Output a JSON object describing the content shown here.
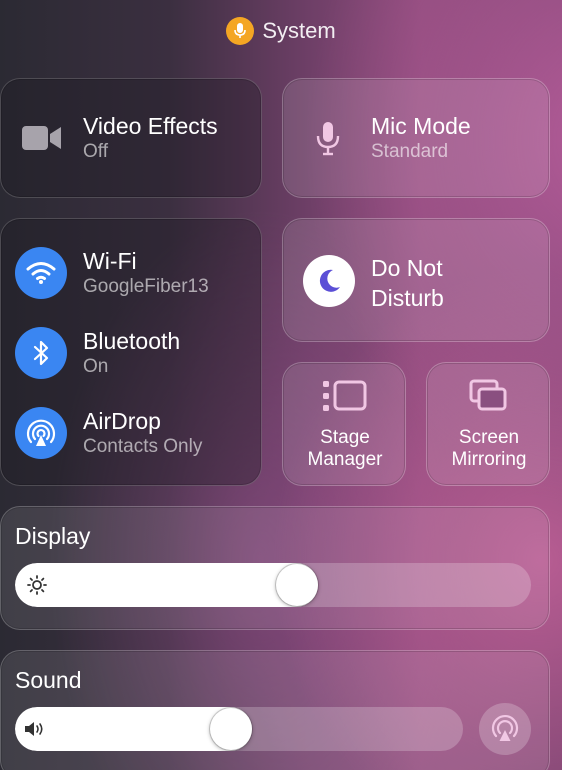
{
  "header": {
    "title": "System",
    "icon": "microphone-icon",
    "badge_color": "#f4a623"
  },
  "video_effects": {
    "title": "Video Effects",
    "status": "Off",
    "icon": "video-camera-icon"
  },
  "mic_mode": {
    "title": "Mic Mode",
    "status": "Standard",
    "icon": "microphone-icon"
  },
  "connectivity": {
    "wifi": {
      "title": "Wi-Fi",
      "status": "GoogleFiber13",
      "icon": "wifi-icon"
    },
    "bluetooth": {
      "title": "Bluetooth",
      "status": "On",
      "icon": "bluetooth-icon"
    },
    "airdrop": {
      "title": "AirDrop",
      "status": "Contacts Only",
      "icon": "airdrop-icon"
    },
    "accent_color": "#3a86f2"
  },
  "do_not_disturb": {
    "line1": "Do Not",
    "line2": "Disturb",
    "icon": "moon-icon"
  },
  "stage_manager": {
    "line1": "Stage",
    "line2": "Manager",
    "icon": "stage-manager-icon"
  },
  "screen_mirroring": {
    "line1": "Screen",
    "line2": "Mirroring",
    "icon": "screen-mirroring-icon"
  },
  "display": {
    "title": "Display",
    "brightness_level": 0.55,
    "icon": "sun-icon"
  },
  "sound": {
    "title": "Sound",
    "volume_level": 0.48,
    "icon": "speaker-icon",
    "output_icon": "airplay-audio-icon"
  }
}
